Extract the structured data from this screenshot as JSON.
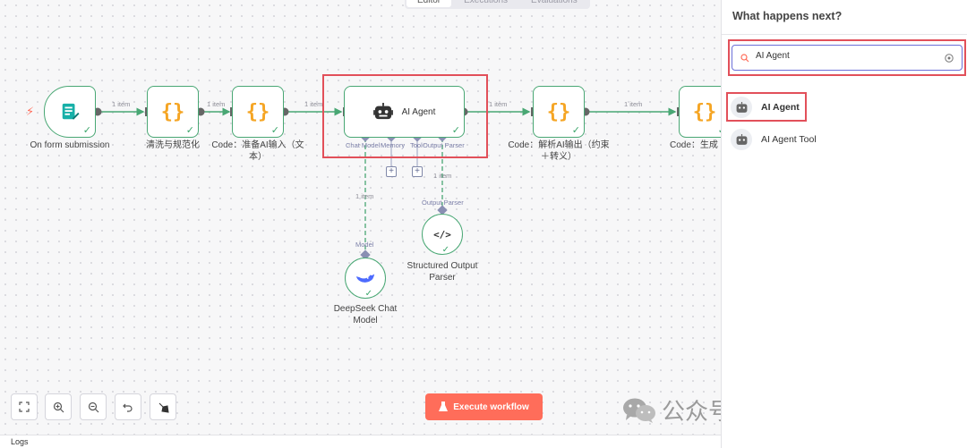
{
  "tabs": [
    {
      "label": "Editor",
      "active": true
    },
    {
      "label": "Executions",
      "active": false
    },
    {
      "label": "Evaluations",
      "active": false
    }
  ],
  "nodes": {
    "trigger": {
      "label": "On form submission"
    },
    "clean": {
      "label": "清洗与规范化"
    },
    "prepare": {
      "label_line1": "Code：准备AI输入（文",
      "label_line2": "本）"
    },
    "agent": {
      "label": "AI Agent"
    },
    "parse": {
      "label_line1": "Code：解析AI输出（约束",
      "label_line2": "＋转义）"
    },
    "generate": {
      "label": "Code：生成"
    },
    "deepseek": {
      "label_line1": "DeepSeek Chat",
      "label_line2": "Model"
    },
    "structured": {
      "label_line1": "Structured Output",
      "label_line2": "Parser"
    }
  },
  "edges": {
    "e1": "1 item",
    "e2": "1 item",
    "e3": "1 item",
    "e4": "1 item",
    "e5": "1 item",
    "model_edge": "1 item",
    "parser_edge": "1 item"
  },
  "ports": {
    "chat_model": "Chat Model",
    "memory": "Memory",
    "tool": "Tool",
    "output_parser": "Output Parser",
    "model_target": "Model",
    "parser_target": "Output Parser"
  },
  "toolbar": {
    "execute_label": "Execute workflow"
  },
  "watermark": {
    "text": "公众号 · 茉茉AI智能体"
  },
  "logs": {
    "label": "Logs"
  },
  "panel": {
    "title": "What happens next?",
    "search_value": "AI Agent",
    "results": [
      {
        "label": "AI Agent",
        "icon": "robot-icon"
      },
      {
        "label": "AI Agent Tool",
        "icon": "robot-icon"
      }
    ]
  },
  "colors": {
    "node_border": "#49a774",
    "braces": "#f5a524",
    "highlight": "#e2505a",
    "execute": "#ff6d5a",
    "search_border": "#6b6fd8"
  }
}
